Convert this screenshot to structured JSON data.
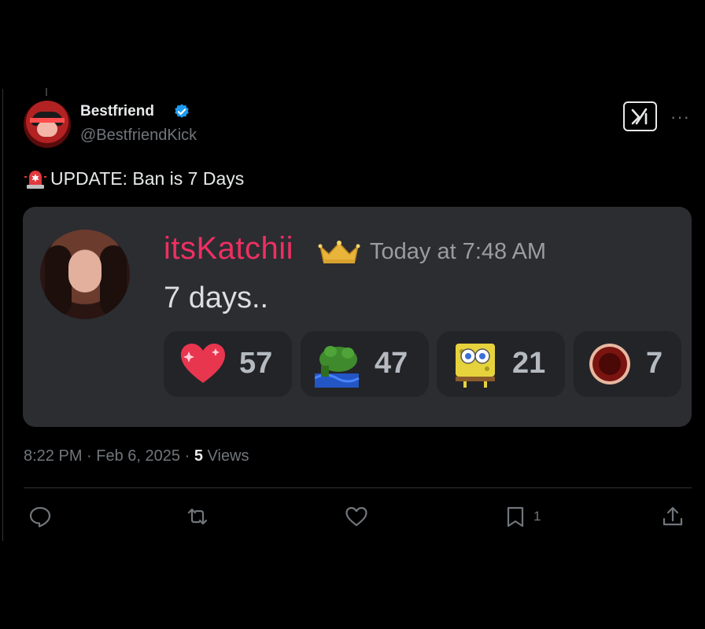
{
  "author": {
    "display_name": "Bestfriend",
    "handle": "@BestfriendKick",
    "verified": true
  },
  "tweet": {
    "icon": "rotating-light-emoji",
    "text": "UPDATE: Ban is 7 Days"
  },
  "embed": {
    "username": "itsKatchii",
    "badge_icon": "crown-icon",
    "timestamp": "Today at 7:48 AM",
    "message": "7 days..",
    "reactions": [
      {
        "emoji": "sparkling-heart-icon",
        "count": "57"
      },
      {
        "emoji": "green-frog-icon",
        "count": "47"
      },
      {
        "emoji": "spongebob-icon",
        "count": "21"
      },
      {
        "emoji": "red-circle-icon",
        "count": "7"
      }
    ]
  },
  "meta": {
    "time": "8:22 PM",
    "separator": "·",
    "date": "Feb 6, 2025",
    "views_count": "5",
    "views_label": "Views"
  },
  "actions": {
    "reply_icon": "reply-icon",
    "retweet_icon": "retweet-icon",
    "like_icon": "like-icon",
    "bookmark_icon": "bookmark-icon",
    "bookmark_count": "1",
    "share_icon": "share-icon"
  },
  "colors": {
    "background": "#000000",
    "embed_bg": "#2b2d31",
    "username": "#ee2f62",
    "verified_blue": "#1d9bf0",
    "muted": "#71767b"
  }
}
